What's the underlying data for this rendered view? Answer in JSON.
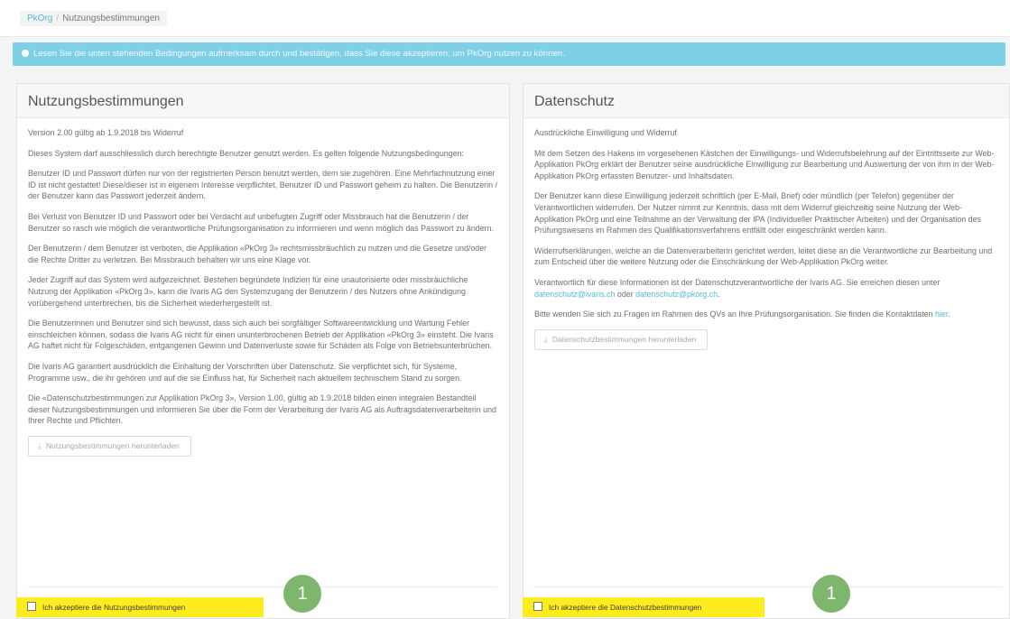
{
  "breadcrumb": {
    "home": "PkOrg",
    "separator": "/",
    "current": "Nutzungsbestimmungen"
  },
  "alert": {
    "text": "Lesen Sie die unten stehenden Bedingungen aufmerksam durch und bestätigen, dass Sie diese akzeptieren, um PkOrg nutzen zu können."
  },
  "terms": {
    "title": "Nutzungsbestimmungen",
    "paragraphs": [
      "Version 2.00 gültig ab 1.9.2018 bis Widerruf",
      "Dieses System darf ausschliesslich durch berechtigte Benutzer genutzt werden. Es gelten folgende Nutzungsbedingungen:",
      "Benutzer ID und Passwort dürfen nur von der registrierten Person benutzt werden, dem sie zugehören. Eine Mehrfachnutzung einer ID ist nicht gestattet! Diese/dieser ist in eigenem Interesse verpflichtet, Benutzer ID und Passwort geheim zu halten. Die Benutzerin / der Benutzer kann das Passwort jederzeit ändern.",
      "Bei Verlust von Benutzer ID und Passwort oder bei Verdacht auf unbefugten Zugriff oder Missbrauch hat die Benutzerin / der Benutzer so rasch wie möglich die verantwortliche Prüfungsorganisation zu informieren und wenn möglich das Passwort zu ändern.",
      "Der Benutzerin / dem Benutzer ist verboten, die Applikation «PkOrg 3» rechtsmissbräuchlich zu nutzen und die Gesetze und/oder die Rechte Dritter zu verletzen. Bei Missbrauch behalten wir uns eine Klage vor.",
      "Jeder Zugriff auf das System wird aufgezeichnet. Bestehen begründete Indizien für eine unautorisierte oder missbräuchliche Nutzung der Applikation «PkOrg 3», kann die Ivaris AG den Systemzugang der Benutzerin / des Nutzers ohne Ankündigung vorübergehend unterbrechen, bis die Sicherheit wiederhergestellt ist.",
      "Die Benutzerinnen und Benutzer sind sich bewusst, dass sich auch bei sorgfältiger Softwareentwicklung und Wartung Fehler einschleichen können, sodass die Ivaris AG nicht für einen ununterbrochenen Betrieb der Applikation «PkOrg 3» einsteht. Die Ivaris AG haftet nicht für Folgeschäden, entgangenen Gewinn und Datenverluste sowie für Schäden als Folge von Betriebsunterbrüchen.",
      "Die Ivaris AG garantiert ausdrücklich die Einhaltung der Vorschriften über Datenschutz. Sie verpflichtet sich, für Systeme, Programme usw., die ihr gehören und auf die sie Einfluss hat, für Sicherheit nach aktuellem technischem Stand zu sorgen.",
      "Die «Datenschutzbestimmungen zur Applikation PkOrg 3», Version 1.00, gültig ab 1.9.2018 bilden einen integralen Bestandteil dieser Nutzungsbestimmungen und informieren Sie über die Form der Verarbeitung der Ivaris AG als Auftragsdatenverarbeiterin und Ihrer Rechte und Pflichten."
    ],
    "download_label": "Nutzungsbestimmungen herunterladen",
    "accept_label": "Ich akzeptiere die Nutzungsbestimmungen"
  },
  "privacy": {
    "title": "Datenschutz",
    "paragraphs": [
      "Ausdrückliche Einwilligung und Widerruf",
      "Mit dem Setzen des Hakens im vorgesehenen Kästchen der Einwilligungs- und Widerrufsbelehrung auf der Eintrittsseite zur Web-Applikation PkOrg erklärt der Benutzer seine ausdrückliche Einwilligung zur Bearbeitung und Auswertung der von ihm in der Web-Applikation PkOrg erfassten Benutzer- und Inhaltsdaten.",
      "Der Benutzer kann diese Einwilligung jederzeit schriftlich (per E-Mail, Brief) oder mündlich (per Telefon) gegenüber der Verantwortlichen widerrufen. Der Nutzer nimmt zur Kenntnis, dass mit dem Widerruf gleichzeitig seine Nutzung der Web-Applikation PkOrg und eine Teilnahme an der Verwaltung der IPA (Individueller Praktischer Arbeiten) und der Organisation des Prüfungswesens im Rahmen des Qualifikationsverfahrens entfällt oder eingeschränkt werden kann.",
      "Widerrufserklärungen, welche an die Datenverarbeiterin gerichtet werden, leitet diese an die Verantwortliche zur Bearbeitung und zum Entscheid über die weitere Nutzung oder die Einschränkung der Web-Applikation PkOrg weiter."
    ],
    "contact_prefix": "Verantwortlich für diese Informationen ist der Datenschutzverantwortliche der Ivaris AG. Sie erreichen diesen unter",
    "contact_email_1": "datenschutz@ivaris.ch",
    "contact_or": "oder",
    "contact_email_2": "datenschutz@pkorg.ch",
    "questions_prefix": "Bitte wenden Sie sich zu Fragen im Rahmen des QVs an Ihre Prüfungsorganisation. Sie finden die Kontaktdaten",
    "questions_link": "hier",
    "download_label": "Datenschutzbestimmungen herunterladen",
    "accept_label": "Ich akzeptiere die Datenschutzbestimmungen"
  },
  "badges": {
    "left": "1",
    "right": "1"
  },
  "colors": {
    "alert": "#7fd0e6",
    "highlight": "#ffec1f",
    "badge": "#7fb66d",
    "link": "#5ab7d6"
  }
}
